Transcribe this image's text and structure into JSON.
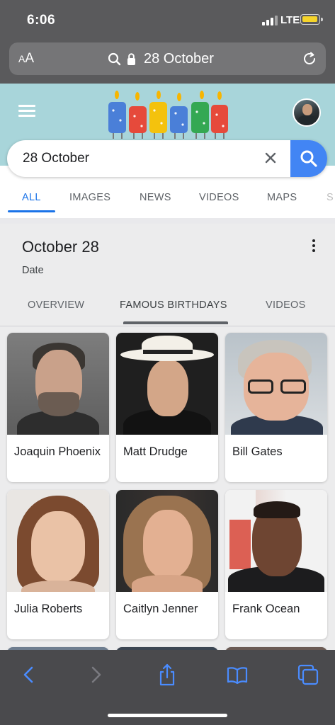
{
  "status_bar": {
    "time": "6:06",
    "network": "LTE"
  },
  "browser": {
    "text_size_label": "AA",
    "url_text": "28 October",
    "icons": [
      "search-icon",
      "lock-icon",
      "reload-icon"
    ]
  },
  "google": {
    "doodle_text": "GOOGLE",
    "search_value": "28 October",
    "tabs": [
      {
        "label": "ALL",
        "active": true
      },
      {
        "label": "IMAGES",
        "active": false
      },
      {
        "label": "NEWS",
        "active": false
      },
      {
        "label": "VIDEOS",
        "active": false
      },
      {
        "label": "MAPS",
        "active": false
      },
      {
        "label": "S",
        "active": false
      }
    ]
  },
  "knowledge_panel": {
    "title": "October 28",
    "subtitle": "Date",
    "tabs": [
      {
        "label": "OVERVIEW",
        "active": false
      },
      {
        "label": "FAMOUS BIRTHDAYS",
        "active": true
      },
      {
        "label": "VIDEOS",
        "active": false
      }
    ]
  },
  "people": [
    {
      "name": "Joaquin Phoenix"
    },
    {
      "name": "Matt Drudge"
    },
    {
      "name": "Bill Gates"
    },
    {
      "name": "Julia Roberts"
    },
    {
      "name": "Caitlyn Jenner"
    },
    {
      "name": "Frank Ocean"
    }
  ],
  "toolbar": {
    "icons": [
      "back-icon",
      "forward-icon",
      "share-icon",
      "bookmarks-icon",
      "tabs-icon"
    ]
  },
  "colors": {
    "accent": "#1a73e8",
    "search_button": "#4285f4",
    "doodle_bg": "#a8d5da",
    "chrome": "#5a5a5c"
  }
}
